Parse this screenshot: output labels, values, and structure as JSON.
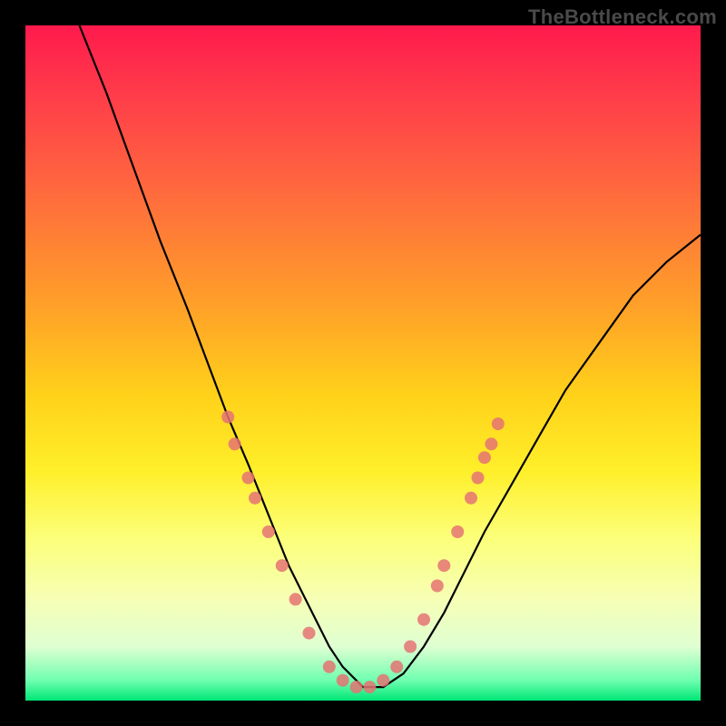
{
  "watermark": "TheBottleneck.com",
  "chart_data": {
    "type": "line",
    "title": "",
    "xlabel": "",
    "ylabel": "",
    "xlim": [
      0,
      100
    ],
    "ylim": [
      0,
      100
    ],
    "series": [
      {
        "name": "bottleneck-curve",
        "x": [
          8,
          12,
          16,
          20,
          24,
          27,
          30,
          33,
          35,
          37,
          39,
          41,
          43,
          45,
          47,
          50,
          53,
          56,
          59,
          62,
          65,
          68,
          72,
          76,
          80,
          85,
          90,
          95,
          100
        ],
        "y": [
          100,
          90,
          79,
          68,
          58,
          50,
          42,
          35,
          30,
          25,
          20,
          16,
          12,
          8,
          5,
          2,
          2,
          4,
          8,
          13,
          19,
          25,
          32,
          39,
          46,
          53,
          60,
          65,
          69
        ]
      }
    ],
    "markers": [
      {
        "x": 30,
        "y": 42
      },
      {
        "x": 31,
        "y": 38
      },
      {
        "x": 33,
        "y": 33
      },
      {
        "x": 34,
        "y": 30
      },
      {
        "x": 36,
        "y": 25
      },
      {
        "x": 38,
        "y": 20
      },
      {
        "x": 40,
        "y": 15
      },
      {
        "x": 42,
        "y": 10
      },
      {
        "x": 45,
        "y": 5
      },
      {
        "x": 47,
        "y": 3
      },
      {
        "x": 49,
        "y": 2
      },
      {
        "x": 51,
        "y": 2
      },
      {
        "x": 53,
        "y": 3
      },
      {
        "x": 55,
        "y": 5
      },
      {
        "x": 57,
        "y": 8
      },
      {
        "x": 59,
        "y": 12
      },
      {
        "x": 61,
        "y": 17
      },
      {
        "x": 62,
        "y": 20
      },
      {
        "x": 64,
        "y": 25
      },
      {
        "x": 66,
        "y": 30
      },
      {
        "x": 67,
        "y": 33
      },
      {
        "x": 68,
        "y": 36
      },
      {
        "x": 69,
        "y": 38
      },
      {
        "x": 70,
        "y": 41
      }
    ],
    "marker_color": "#e57373",
    "curve_color": "#000000",
    "background_gradient": [
      "#ff1a4d",
      "#ffd21a",
      "#00e676"
    ]
  }
}
